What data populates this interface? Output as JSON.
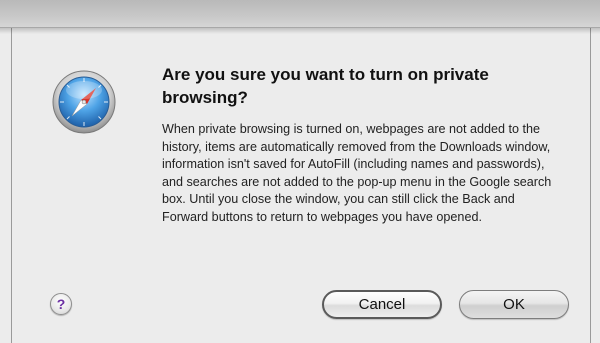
{
  "dialog": {
    "title": "Are you sure you want to turn on private browsing?",
    "message": "When private browsing is turned on, webpages are not added to the history, items are automatically removed from the Downloads window, information isn't saved for AutoFill (including names and passwords), and searches are not added to the pop-up menu in the Google search box. Until you close the window, you can still click the Back and Forward buttons to return to webpages you have opened.",
    "help_label": "?",
    "cancel_label": "Cancel",
    "ok_label": "OK",
    "icon": "safari-compass-icon"
  },
  "colors": {
    "background": "#ececec",
    "help_glyph": "#6b2fa2"
  }
}
